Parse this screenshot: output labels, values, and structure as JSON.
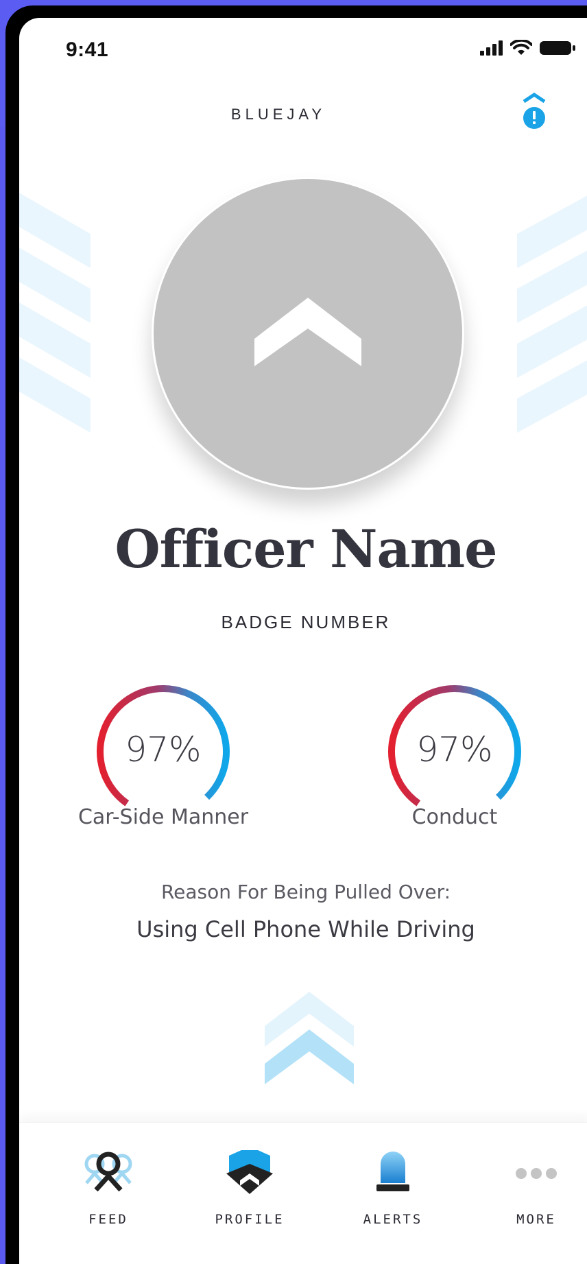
{
  "status_bar": {
    "time": "9:41"
  },
  "header": {
    "brand": "BLUEJAY"
  },
  "profile": {
    "name": "Officer Name",
    "badge": "BADGE NUMBER"
  },
  "ratings": [
    {
      "value": "97%",
      "label": "Car-Side Manner",
      "fraction": 0.97
    },
    {
      "value": "97%",
      "label": "Conduct",
      "fraction": 0.97
    }
  ],
  "reason": {
    "title": "Reason For Being Pulled Over:",
    "value": "Using Cell Phone While Driving"
  },
  "tabs": [
    {
      "label": "FEED",
      "icon": "feed-icon"
    },
    {
      "label": "PROFILE",
      "icon": "profile-shield-icon"
    },
    {
      "label": "ALERTS",
      "icon": "siren-icon"
    },
    {
      "label": "MORE",
      "icon": "more-dots-icon"
    }
  ],
  "colors": {
    "accent_blue": "#1aa3e6",
    "accent_red": "#e3202f",
    "avatar_gray": "#c2c2c2",
    "frame_purple": "#5b5cf2"
  }
}
